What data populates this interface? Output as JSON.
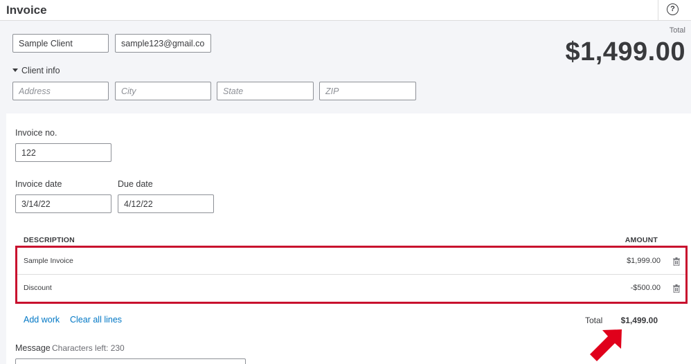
{
  "page": {
    "title": "Invoice",
    "help_icon": "question-circle-icon"
  },
  "client": {
    "name_value": "Sample Client",
    "email_value": "sample123@gmail.com",
    "client_info_label": "Client info",
    "address_placeholder": "Address",
    "city_placeholder": "City",
    "state_placeholder": "State",
    "zip_placeholder": "ZIP"
  },
  "summary": {
    "total_label": "Total",
    "total_amount": "$1,499.00"
  },
  "invoice": {
    "number_label": "Invoice no.",
    "number_value": "122",
    "date_label": "Invoice date",
    "date_value": "3/14/22",
    "due_label": "Due date",
    "due_value": "4/12/22"
  },
  "lines": {
    "headers": {
      "description": "DESCRIPTION",
      "amount": "AMOUNT"
    },
    "rows": [
      {
        "description": "Sample Invoice",
        "amount": "$1,999.00",
        "icon": "trash-icon"
      },
      {
        "description": "Discount",
        "amount": "-$500.00",
        "icon": "trash-icon"
      }
    ],
    "add_work_label": "Add work",
    "clear_lines_label": "Clear all lines",
    "total_label": "Total",
    "total_value": "$1,499.00"
  },
  "message": {
    "label": "Message",
    "hint": "Characters left: 230"
  },
  "colors": {
    "highlight_border": "#c8102e",
    "annotation_arrow": "#e0001b",
    "link": "#0077c5"
  }
}
